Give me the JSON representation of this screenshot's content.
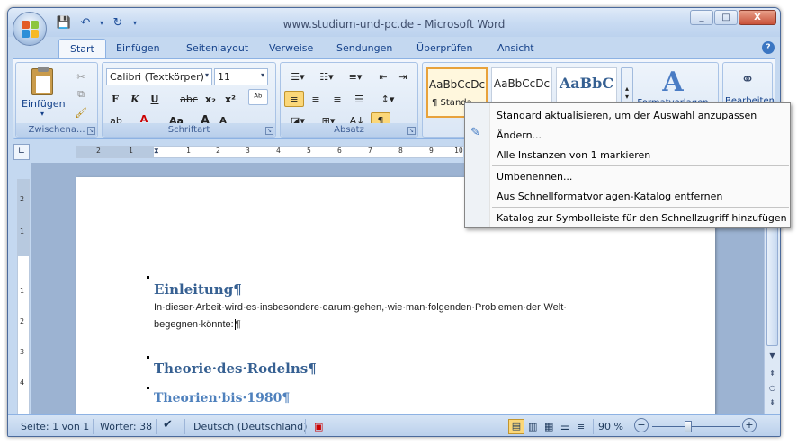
{
  "window": {
    "title": "www.studium-und-pc.de - Microsoft Word",
    "min": "_",
    "max": "□",
    "close": "X"
  },
  "tabs": [
    "Start",
    "Einfügen",
    "Seitenlayout",
    "Verweise",
    "Sendungen",
    "Überprüfen",
    "Ansicht"
  ],
  "ribbon": {
    "clipboard": {
      "label": "Zwischena...",
      "paste": "Einfügen"
    },
    "font": {
      "label": "Schriftart",
      "family": "Calibri (Textkörper)",
      "size": "11",
      "bold": "F",
      "italic": "K",
      "underline": "U",
      "strike": "abc",
      "sub": "x₂",
      "sup": "x²",
      "case": "Aa",
      "grow": "A",
      "shrink": "A"
    },
    "paragraph": {
      "label": "Absatz"
    },
    "styles": {
      "samples": [
        "AaBbCcDc",
        "AaBbCcDc",
        "AaBbC"
      ],
      "first_name": "¶ Standa",
      "change": "Formatvorlagen",
      "edit": "Bearbeiten"
    }
  },
  "ruler": {
    "h_ticks": [
      "2",
      "1",
      "1",
      "2",
      "3",
      "4",
      "5",
      "6",
      "7",
      "8",
      "9",
      "10"
    ],
    "v_ticks": [
      "2",
      "1",
      "1",
      "2",
      "3",
      "4"
    ]
  },
  "document": {
    "h1": "Einleitung¶",
    "para1": "In·dieser·Arbeit·wird·es·insbesondere·darum·gehen,·wie·man·folgenden·Problemen·der·Welt·",
    "para2": "begegnen·könnte:",
    "pilcrow": "¶",
    "h2": "Theorie·des·Rodelns¶",
    "h3": "Theorien·bis·1980¶"
  },
  "context_menu": [
    "Standard aktualisieren, um der Auswahl anzupassen",
    "Ändern...",
    "Alle Instanzen von 1 markieren",
    "Umbenennen...",
    "Aus Schnellformatvorlagen-Katalog entfernen",
    "Katalog zur Symbolleiste für den Schnellzugriff hinzufügen"
  ],
  "status": {
    "page": "Seite: 1 von 1",
    "words": "Wörter: 38",
    "language": "Deutsch (Deutschland)",
    "zoom": "90 %",
    "zoom_out": "−",
    "zoom_in": "+"
  },
  "colors": {
    "accent": "#15428b",
    "heading": "#366092",
    "ribbon": "#dbe7f5"
  }
}
